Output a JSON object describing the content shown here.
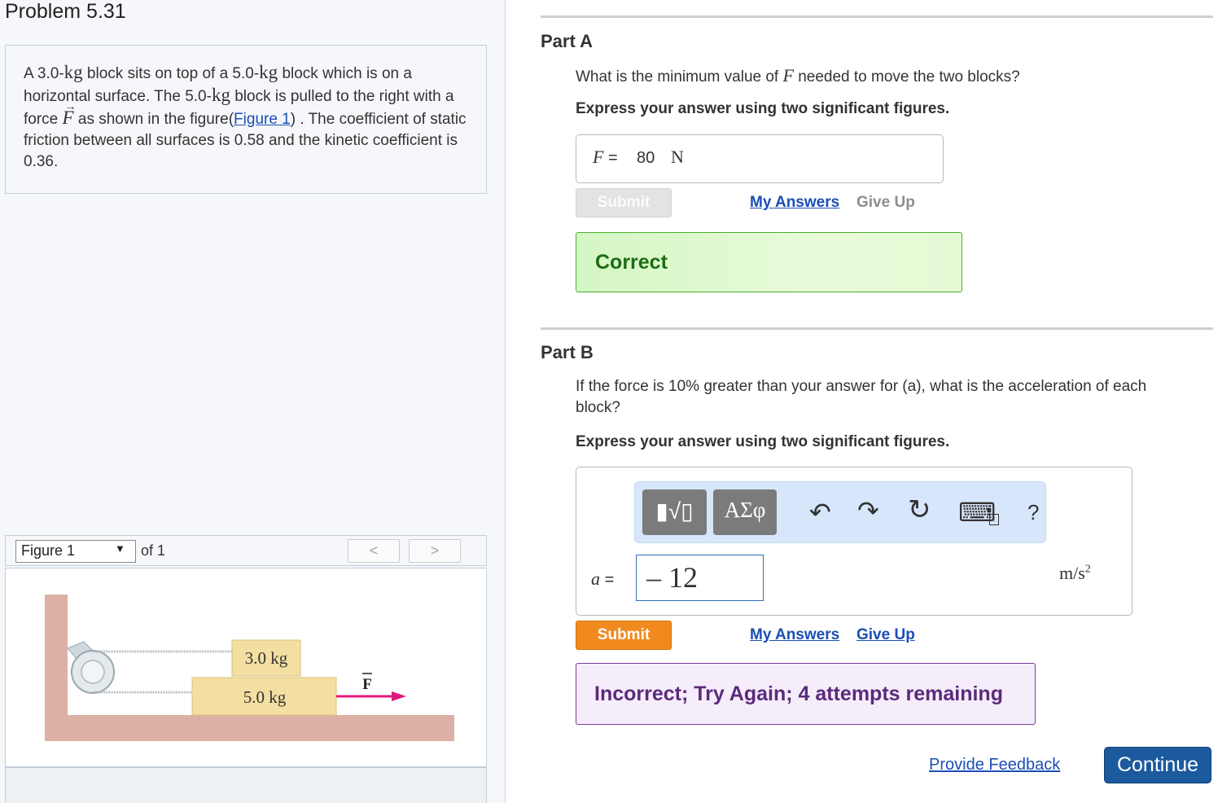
{
  "problem": {
    "title": "Problem 5.31",
    "text_parts": {
      "p1": "A 3.0-",
      "kg1": "kg",
      "p2": " block sits on top of a 5.0-",
      "kg2": "kg",
      "p3": " block which is on a horizontal surface. The 5.0-",
      "kg3": "kg",
      "p4": " block is pulled to the right with a force ",
      "force_symbol": "F",
      "p5": " as shown in the figure(",
      "figure_link": "Figure 1",
      "p6": ") . The coefficient of static friction between all surfaces is 0.58 and the kinetic coefficient is 0.36."
    }
  },
  "figure": {
    "selector_value": "Figure 1",
    "of_label": "of 1",
    "prev_label": "<",
    "next_label": ">",
    "top_block_label": "3.0 kg",
    "bottom_block_label": "5.0 kg",
    "force_label": "F"
  },
  "part_a": {
    "title": "Part A",
    "question_pre": "What is the minimum value of ",
    "question_symbol": "F",
    "question_post": " needed to move the two blocks?",
    "instruction": "Express your answer using two significant figures.",
    "answer_label": "F",
    "answer_equals": "=",
    "answer_value": "80",
    "answer_unit": "N",
    "submit_label": "Submit",
    "my_answers_label": "My Answers",
    "give_up_label": "Give Up",
    "feedback": "Correct"
  },
  "part_b": {
    "title": "Part B",
    "question": "If the force is 10% greater than your answer for (a), what is the acceleration of each block?",
    "instruction": "Express your answer using two significant figures.",
    "toolbar": {
      "templates_label": "▮√▯",
      "greek_label": "ΑΣφ",
      "undo_icon": "↶",
      "redo_icon": "↷",
      "reset_icon": "↻",
      "keyboard_icon": "⌨",
      "help_label": "?"
    },
    "answer_label": "a",
    "answer_equals": "=",
    "answer_value": "– 12",
    "answer_unit_base": "m/s",
    "answer_unit_exp": "2",
    "submit_label": "Submit",
    "my_answers_label": "My Answers",
    "give_up_label": "Give Up",
    "feedback": "Incorrect; Try Again; 4 attempts remaining"
  },
  "footer": {
    "provide_feedback_label": "Provide Feedback",
    "continue_label": "Continue"
  },
  "colors": {
    "link": "#1a4fb5",
    "submit_active": "#f08a1e",
    "correct_border": "#4caf2b",
    "incorrect_border": "#7a3d99",
    "continue_bg": "#1c5a9e"
  }
}
